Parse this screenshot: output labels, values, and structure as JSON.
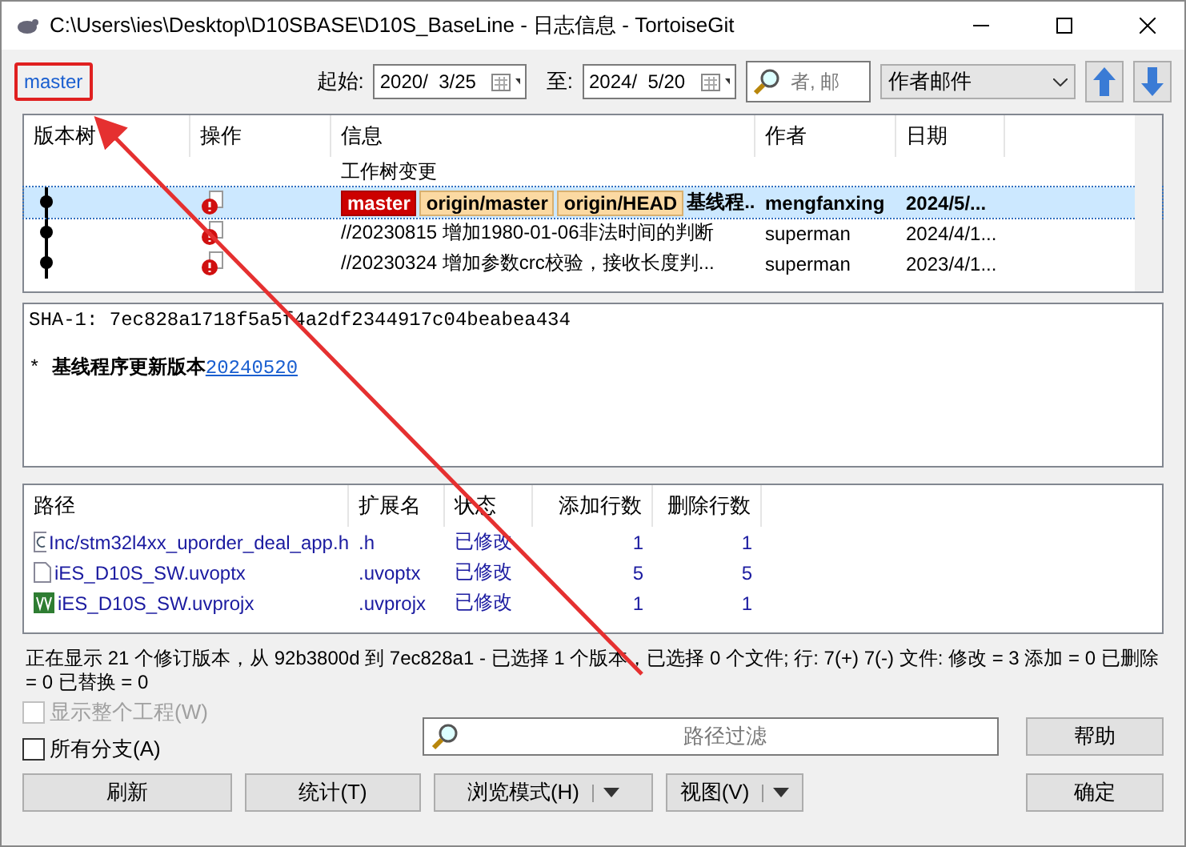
{
  "window": {
    "title": "C:\\Users\\ies\\Desktop\\D10SBASE\\D10S_BaseLine - 日志信息 - TortoiseGit"
  },
  "branch": {
    "label": "master",
    "highlighted": true
  },
  "toolbar": {
    "from_label": "起始:",
    "from_date": "2020/  3/25",
    "to_label": "至:",
    "to_date": "2024/  5/20",
    "search_placeholder": "者, 邮",
    "filter": "作者邮件"
  },
  "log": {
    "columns": [
      "版本树",
      "操作",
      "信息",
      "作者",
      "日期"
    ],
    "rows": [
      {
        "kind": "working-tree",
        "message": "工作树变更",
        "selected": false
      },
      {
        "kind": "commit",
        "refs": [
          {
            "label": "master",
            "kind": "local"
          },
          {
            "label": "origin/master",
            "kind": "remote"
          },
          {
            "label": "origin/HEAD",
            "kind": "remote"
          }
        ],
        "message": "基线程...",
        "author": "mengfanxing",
        "date": "2024/5/...",
        "selected": true
      },
      {
        "kind": "commit",
        "refs": [],
        "message": "//20230815 增加1980-01-06非法时间的判断",
        "author": "superman",
        "date": "2024/4/1...",
        "selected": false
      },
      {
        "kind": "commit",
        "refs": [],
        "message": "//20230324 增加参数crc校验，接收长度判...",
        "author": "superman",
        "date": "2023/4/1...",
        "selected": false
      }
    ]
  },
  "details": {
    "sha": "SHA-1: 7ec828a1718f5a5f4a2df2344917c04beabea434",
    "message": "* **基线程序更新版本**",
    "link": "20240520"
  },
  "files": {
    "columns": [
      "路径",
      "扩展名",
      "状态",
      "添加行数",
      "删除行数"
    ],
    "rows": [
      {
        "kind": "c",
        "path": "Inc/stm32l4xx_uporder_deal_app.h",
        "ext": ".h",
        "status": "已修改",
        "added": "1",
        "removed": "1"
      },
      {
        "kind": "plain",
        "path": "iES_D10S_SW.uvoptx",
        "ext": ".uvoptx",
        "status": "已修改",
        "added": "5",
        "removed": "5"
      },
      {
        "kind": "uvision",
        "path": "iES_D10S_SW.uvprojx",
        "ext": ".uvprojx",
        "status": "已修改",
        "added": "1",
        "removed": "1"
      }
    ]
  },
  "status_text": "正在显示 21 个修订版本，从 92b3800d 到 7ec828a1 - 已选择 1 个版本，已选择 0 个文件; 行: 7(+) 7(-) 文件: 修改 = 3 添加 = 0 已删除 = 0 已替换 = 0",
  "options": [
    {
      "label": "显示整个工程(W)",
      "checked": false,
      "disabled": true
    },
    {
      "label": "所有分支(A)",
      "checked": false,
      "disabled": false
    }
  ],
  "path_filter": {
    "placeholder": "路径过滤"
  },
  "buttons": [
    {
      "label": "帮助",
      "kind": "plain"
    },
    {
      "label": "刷新",
      "kind": "plain"
    },
    {
      "label": "统计(T)",
      "kind": "plain"
    },
    {
      "label": "浏览模式(H)",
      "kind": "split"
    },
    {
      "label": "视图(V)",
      "kind": "split"
    },
    {
      "label": "确定",
      "kind": "plain"
    }
  ]
}
